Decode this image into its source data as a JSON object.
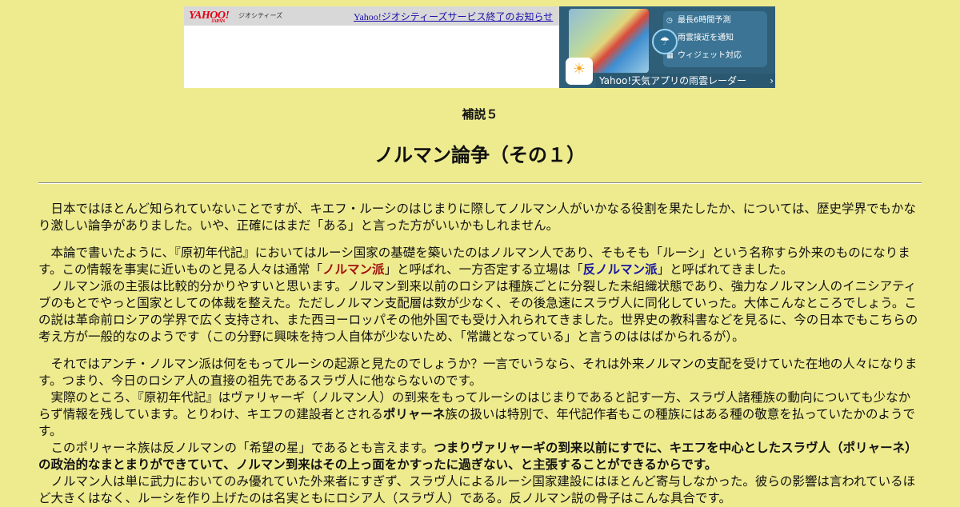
{
  "banner": {
    "logo": "YAHOO!",
    "logo_sub": "JAPAN",
    "brand": "ジオシティーズ",
    "notice": "Yahoo!ジオシティーズサービス終了のお知らせ"
  },
  "ad": {
    "features": [
      "最長6時間予測",
      "雨雲接近を通知",
      "ウィジェット対応"
    ],
    "footer": "Yahoo!天気アプリの雨雲レーダー"
  },
  "page": {
    "supplement": "補説５",
    "title": "ノルマン論争（その１）"
  },
  "paragraphs": {
    "p1": "日本ではほとんど知られていないことですが、キエフ・ルーシのはじまりに際してノルマン人がいかなる役割を果たしたか、については、歴史学界でもかなり激しい論争がありました。いや、正確にはまだ「ある」と言った方がいいかもしれません。",
    "p2a": "本論で書いたように、『原初年代記』においてはルーシ国家の基礎を築いたのはノルマン人であり、そもそも「ルーシ」という名称すら外来のものになります。この情報を事実に近いものと見る人々は通常「",
    "p2_normanist": "ノルマン派",
    "p2b": "」と呼ばれ、一方否定する立場は「",
    "p2_anti": "反ノルマン派",
    "p2c": "」と呼ばれてきました。",
    "p3": "ノルマン派の主張は比較的分かりやすいと思います。ノルマン到来以前のロシアは種族ごとに分裂した未組織状態であり、強力なノルマン人のイニシアティブのもとでやっと国家としての体裁を整えた。ただしノルマン支配層は数が少なく、その後急速にスラヴ人に同化していった。大体こんなところでしょう。この説は革命前ロシアの学界で広く支持され、また西ヨーロッパその他外国でも受け入れられてきました。世界史の教科書などを見るに、今の日本でもこちらの考え方が一般的なのようです（この分野に興味を持つ人自体が少ないため、「常識となっている」と言うのははばかられるが）。",
    "p4": "それではアンチ・ノルマン派は何をもってルーシの起源と見たのでしょうか？一言でいうなら、それは外来ノルマンの支配を受けていた在地の人々になります。つまり、今日のロシア人の直接の祖先であるスラヴ人に他ならないのです。",
    "p5a": "実際のところ、『原初年代記』はヴァリャーギ（ノルマン人）の到来をもってルーシのはじまりであると記す一方、スラヴ人諸種族の動向についても少なからず情報を残しています。とりわけ、キエフの建設者とされる",
    "p5_bold": "ポリャーネ",
    "p5b": "族の扱いは特別で、年代記作者もこの種族にはある種の敬意を払っていたかのようです。",
    "p6a": "このポリャーネ族は反ノルマンの「希望の星」であるとも言えます。",
    "p6_bold": "つまりヴァリャーギの到来以前にすでに、キエフを中心としたスラヴ人（ポリャーネ）の政治的なまとまりができていて、ノルマン到来はその上っ面をかすったに過ぎない、と主張することができるからです。",
    "p7": "ノルマン人は単に武力においてのみ優れていた外来者にすぎず、スラヴ人によるルーシ国家建設にはほとんど寄与しなかった。彼らの影響は言われているほど大きくはなく、ルーシを作り上げたのは名実ともにロシア人（スラヴ人）である。反ノルマン説の骨子はこんな具合です。"
  }
}
